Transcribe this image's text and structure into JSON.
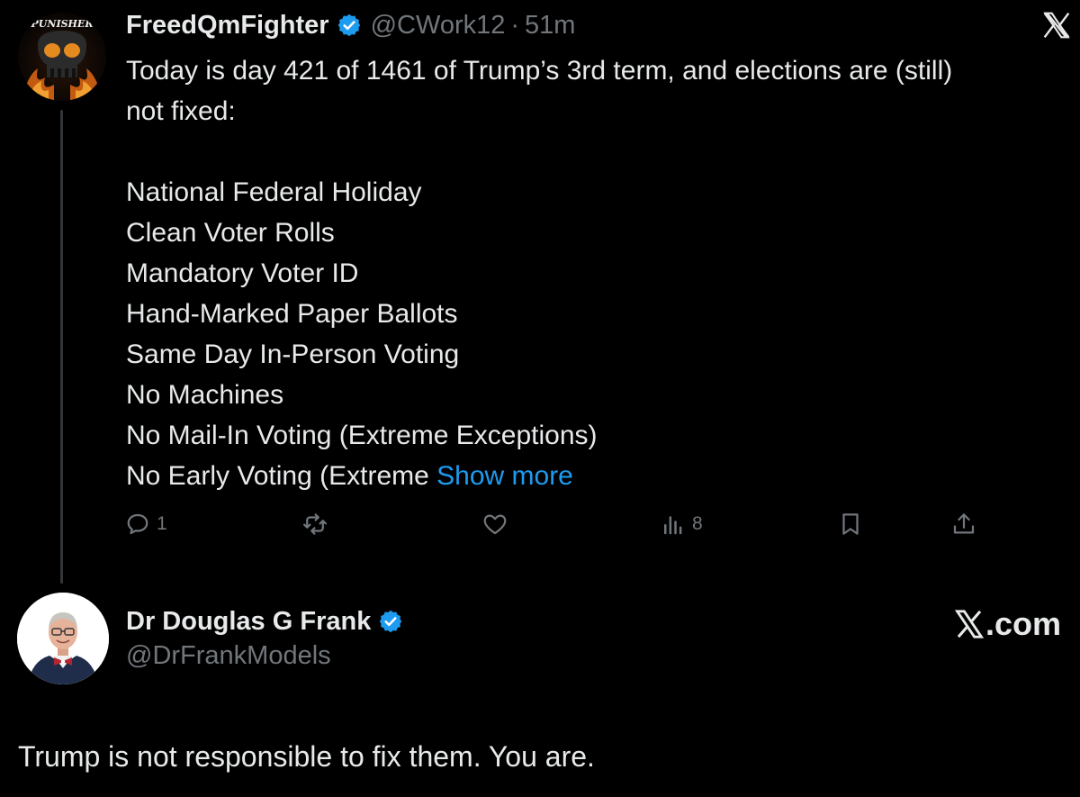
{
  "tweet1": {
    "author_name": "FreedQmFighter",
    "handle": "@CWork12",
    "separator": "·",
    "time": "51m",
    "avatar_text": "PUNISHER",
    "lines": [
      "Today is day 421 of 1461 of Trump’s 3rd term, and elections are (still)",
      "not fixed:"
    ],
    "list": [
      "National Federal Holiday",
      "Clean Voter Rolls",
      "Mandatory Voter ID",
      "Hand-Marked Paper Ballots",
      "Same Day In-Person Voting",
      "No Machines",
      "No Mail-In Voting (Extreme Exceptions)"
    ],
    "last_line": "No Early Voting (Extreme ",
    "show_more": "Show more",
    "actions": {
      "reply_count": "1",
      "views_count": "8"
    }
  },
  "tweet2": {
    "author_name": "Dr Douglas G Frank",
    "handle": "@DrFrankModels",
    "source": ".com",
    "text": "Trump is not responsible to fix them. You are."
  },
  "colors": {
    "background": "#000000",
    "text": "#e7e9ea",
    "muted": "#71767b",
    "accent": "#1d9bf0"
  },
  "icons": [
    "verified-badge-icon",
    "x-logo-icon",
    "reply-icon",
    "retweet-icon",
    "like-icon",
    "views-icon",
    "bookmark-icon",
    "share-icon"
  ]
}
